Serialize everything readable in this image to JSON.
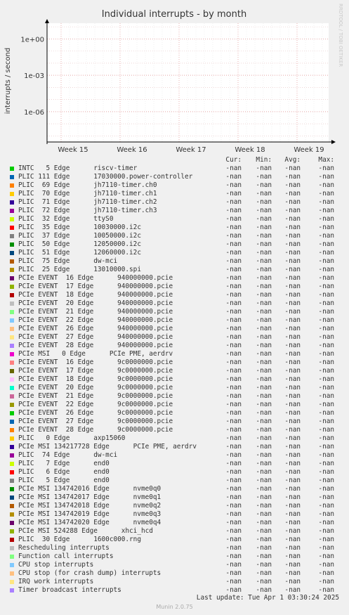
{
  "chart_data": {
    "type": "line",
    "title": "Individual interrupts - by month",
    "ylabel": "interrupts / second",
    "y_scale": "log",
    "y_ticks": [
      "1e-06",
      "1e-03",
      "1e+00"
    ],
    "x_ticks": [
      "Week 15",
      "Week 16",
      "Week 17",
      "Week 18",
      "Week 19"
    ],
    "watermark": "RRDTOOL / TOBI OETIKER",
    "columns": [
      "Cur:",
      "Min:",
      "Avg:",
      "Max:"
    ],
    "series": [
      {
        "name": "INTC   5 Edge      riscv-timer",
        "color": "#00cc00",
        "cur": "-nan",
        "min": "-nan",
        "avg": "-nan",
        "max": "-nan"
      },
      {
        "name": "PLIC 111 Edge      17030000.power-controller",
        "color": "#0066b3",
        "cur": "-nan",
        "min": "-nan",
        "avg": "-nan",
        "max": "-nan"
      },
      {
        "name": "PLIC  69 Edge      jh7110-timer.ch0",
        "color": "#ff8000",
        "cur": "-nan",
        "min": "-nan",
        "avg": "-nan",
        "max": "-nan"
      },
      {
        "name": "PLIC  70 Edge      jh7110-timer.ch1",
        "color": "#ffcc00",
        "cur": "-nan",
        "min": "-nan",
        "avg": "-nan",
        "max": "-nan"
      },
      {
        "name": "PLIC  71 Edge      jh7110-timer.ch2",
        "color": "#330099",
        "cur": "-nan",
        "min": "-nan",
        "avg": "-nan",
        "max": "-nan"
      },
      {
        "name": "PLIC  72 Edge      jh7110-timer.ch3",
        "color": "#990099",
        "cur": "-nan",
        "min": "-nan",
        "avg": "-nan",
        "max": "-nan"
      },
      {
        "name": "PLIC  32 Edge      ttyS0",
        "color": "#ccff00",
        "cur": "-nan",
        "min": "-nan",
        "avg": "-nan",
        "max": "-nan"
      },
      {
        "name": "PLIC  35 Edge      10030000.i2c",
        "color": "#ff0000",
        "cur": "-nan",
        "min": "-nan",
        "avg": "-nan",
        "max": "-nan"
      },
      {
        "name": "PLIC  37 Edge      10050000.i2c",
        "color": "#808080",
        "cur": "-nan",
        "min": "-nan",
        "avg": "-nan",
        "max": "-nan"
      },
      {
        "name": "PLIC  50 Edge      12050000.i2c",
        "color": "#008f00",
        "cur": "-nan",
        "min": "-nan",
        "avg": "-nan",
        "max": "-nan"
      },
      {
        "name": "PLIC  51 Edge      12060000.i2c",
        "color": "#00487d",
        "cur": "-nan",
        "min": "-nan",
        "avg": "-nan",
        "max": "-nan"
      },
      {
        "name": "PLIC  75 Edge      dw-mci",
        "color": "#b35a00",
        "cur": "-nan",
        "min": "-nan",
        "avg": "-nan",
        "max": "-nan"
      },
      {
        "name": "PLIC  25 Edge      13010000.spi",
        "color": "#b38f00",
        "cur": "-nan",
        "min": "-nan",
        "avg": "-nan",
        "max": "-nan"
      },
      {
        "name": "PCIe EVENT  16 Edge      940000000.pcie",
        "color": "#6b006b",
        "cur": "-nan",
        "min": "-nan",
        "avg": "-nan",
        "max": "-nan"
      },
      {
        "name": "PCIe EVENT  17 Edge      940000000.pcie",
        "color": "#8fb300",
        "cur": "-nan",
        "min": "-nan",
        "avg": "-nan",
        "max": "-nan"
      },
      {
        "name": "PCIe EVENT  18 Edge      940000000.pcie",
        "color": "#b30000",
        "cur": "-nan",
        "min": "-nan",
        "avg": "-nan",
        "max": "-nan"
      },
      {
        "name": "PCIe EVENT  20 Edge      940000000.pcie",
        "color": "#bebebe",
        "cur": "-nan",
        "min": "-nan",
        "avg": "-nan",
        "max": "-nan"
      },
      {
        "name": "PCIe EVENT  21 Edge      940000000.pcie",
        "color": "#80ff80",
        "cur": "-nan",
        "min": "-nan",
        "avg": "-nan",
        "max": "-nan"
      },
      {
        "name": "PCIe EVENT  22 Edge      940000000.pcie",
        "color": "#80c9ff",
        "cur": "-nan",
        "min": "-nan",
        "avg": "-nan",
        "max": "-nan"
      },
      {
        "name": "PCIe EVENT  26 Edge      940000000.pcie",
        "color": "#ffc080",
        "cur": "-nan",
        "min": "-nan",
        "avg": "-nan",
        "max": "-nan"
      },
      {
        "name": "PCIe EVENT  27 Edge      940000000.pcie",
        "color": "#ffe680",
        "cur": "-nan",
        "min": "-nan",
        "avg": "-nan",
        "max": "-nan"
      },
      {
        "name": "PCIe EVENT  28 Edge      940000000.pcie",
        "color": "#aa80ff",
        "cur": "-nan",
        "min": "-nan",
        "avg": "-nan",
        "max": "-nan"
      },
      {
        "name": "PCIe MSI   0 Edge      PCIe PME, aerdrv",
        "color": "#ee00cc",
        "cur": "-nan",
        "min": "-nan",
        "avg": "-nan",
        "max": "-nan"
      },
      {
        "name": "PCIe EVENT  16 Edge      9c0000000.pcie",
        "color": "#ff8080",
        "cur": "-nan",
        "min": "-nan",
        "avg": "-nan",
        "max": "-nan"
      },
      {
        "name": "PCIe EVENT  17 Edge      9c0000000.pcie",
        "color": "#666600",
        "cur": "-nan",
        "min": "-nan",
        "avg": "-nan",
        "max": "-nan"
      },
      {
        "name": "PCIe EVENT  18 Edge      9c0000000.pcie",
        "color": "#ffbfff",
        "cur": "-nan",
        "min": "-nan",
        "avg": "-nan",
        "max": "-nan"
      },
      {
        "name": "PCIe EVENT  20 Edge      9c0000000.pcie",
        "color": "#00ffcc",
        "cur": "-nan",
        "min": "-nan",
        "avg": "-nan",
        "max": "-nan"
      },
      {
        "name": "PCIe EVENT  21 Edge      9c0000000.pcie",
        "color": "#cc6699",
        "cur": "-nan",
        "min": "-nan",
        "avg": "-nan",
        "max": "-nan"
      },
      {
        "name": "PCIe EVENT  22 Edge      9c0000000.pcie",
        "color": "#999900",
        "cur": "-nan",
        "min": "-nan",
        "avg": "-nan",
        "max": "-nan"
      },
      {
        "name": "PCIe EVENT  26 Edge      9c0000000.pcie",
        "color": "#00cc00",
        "cur": "-nan",
        "min": "-nan",
        "avg": "-nan",
        "max": "-nan"
      },
      {
        "name": "PCIe EVENT  27 Edge      9c0000000.pcie",
        "color": "#0066b3",
        "cur": "-nan",
        "min": "-nan",
        "avg": "-nan",
        "max": "-nan"
      },
      {
        "name": "PCIe EVENT  28 Edge      9c0000000.pcie",
        "color": "#ff8000",
        "cur": "-nan",
        "min": "-nan",
        "avg": "-nan",
        "max": "-nan"
      },
      {
        "name": "PLIC   0 Edge      axp15060",
        "color": "#ffcc00",
        "cur": "-nan",
        "min": "-nan",
        "avg": "-nan",
        "max": "-nan"
      },
      {
        "name": "PCIe MSI 134217728 Edge      PCIe PME, aerdrv",
        "color": "#330099",
        "cur": "-nan",
        "min": "-nan",
        "avg": "-nan",
        "max": "-nan"
      },
      {
        "name": "PLIC  74 Edge      dw-mci",
        "color": "#990099",
        "cur": "-nan",
        "min": "-nan",
        "avg": "-nan",
        "max": "-nan"
      },
      {
        "name": "PLIC   7 Edge      end0",
        "color": "#ccff00",
        "cur": "-nan",
        "min": "-nan",
        "avg": "-nan",
        "max": "-nan"
      },
      {
        "name": "PLIC   6 Edge      end0",
        "color": "#ff0000",
        "cur": "-nan",
        "min": "-nan",
        "avg": "-nan",
        "max": "-nan"
      },
      {
        "name": "PLIC   5 Edge      end0",
        "color": "#808080",
        "cur": "-nan",
        "min": "-nan",
        "avg": "-nan",
        "max": "-nan"
      },
      {
        "name": "PCIe MSI 134742016 Edge      nvme0q0",
        "color": "#008f00",
        "cur": "-nan",
        "min": "-nan",
        "avg": "-nan",
        "max": "-nan"
      },
      {
        "name": "PCIe MSI 134742017 Edge      nvme0q1",
        "color": "#00487d",
        "cur": "-nan",
        "min": "-nan",
        "avg": "-nan",
        "max": "-nan"
      },
      {
        "name": "PCIe MSI 134742018 Edge      nvme0q2",
        "color": "#b35a00",
        "cur": "-nan",
        "min": "-nan",
        "avg": "-nan",
        "max": "-nan"
      },
      {
        "name": "PCIe MSI 134742019 Edge      nvme0q3",
        "color": "#b38f00",
        "cur": "-nan",
        "min": "-nan",
        "avg": "-nan",
        "max": "-nan"
      },
      {
        "name": "PCIe MSI 134742020 Edge      nvme0q4",
        "color": "#6b006b",
        "cur": "-nan",
        "min": "-nan",
        "avg": "-nan",
        "max": "-nan"
      },
      {
        "name": "PCIe MSI 524288 Edge      xhci_hcd",
        "color": "#8fb300",
        "cur": "-nan",
        "min": "-nan",
        "avg": "-nan",
        "max": "-nan"
      },
      {
        "name": "PLIC  30 Edge      1600c000.rng",
        "color": "#b30000",
        "cur": "-nan",
        "min": "-nan",
        "avg": "-nan",
        "max": "-nan"
      },
      {
        "name": "Rescheduling interrupts",
        "color": "#bebebe",
        "cur": "-nan",
        "min": "-nan",
        "avg": "-nan",
        "max": "-nan"
      },
      {
        "name": "Function call interrupts",
        "color": "#80ff80",
        "cur": "-nan",
        "min": "-nan",
        "avg": "-nan",
        "max": "-nan"
      },
      {
        "name": "CPU stop interrupts",
        "color": "#80c9ff",
        "cur": "-nan",
        "min": "-nan",
        "avg": "-nan",
        "max": "-nan"
      },
      {
        "name": "CPU stop (for crash dump) interrupts",
        "color": "#ffc080",
        "cur": "-nan",
        "min": "-nan",
        "avg": "-nan",
        "max": "-nan"
      },
      {
        "name": "IRQ work interrupts",
        "color": "#ffe680",
        "cur": "-nan",
        "min": "-nan",
        "avg": "-nan",
        "max": "-nan"
      },
      {
        "name": "Timer broadcast interrupts",
        "color": "#aa80ff",
        "cur": "-nan",
        "min": "-nan",
        "avg": "-nan",
        "max": "-nan"
      }
    ]
  },
  "footer": {
    "last_update": "Last update: Tue Apr  1 03:30:24 2025",
    "munin_version": "Munin 2.0.75"
  }
}
